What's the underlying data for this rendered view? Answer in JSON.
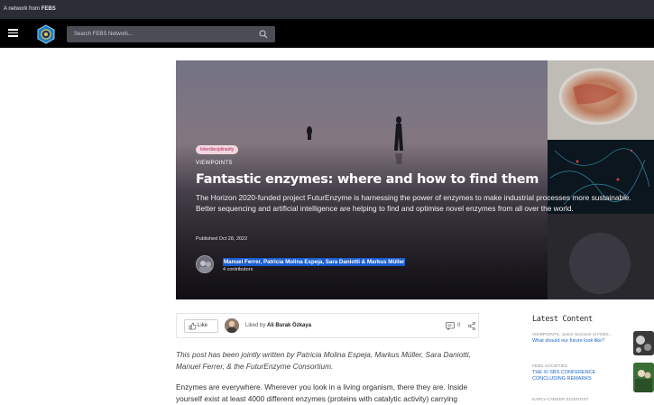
{
  "topbar": {
    "prefix": "A network from",
    "brand": "FEBS"
  },
  "nav": {
    "search_placeholder": "Search FEBS Network..."
  },
  "hero": {
    "tag": "Interdisciplinarity",
    "kicker": "VIEWPOINTS",
    "title": "Fantastic enzymes: where and how to find them",
    "subtitle": "The Horizon 2020-funded project FuturEnzyme is harnessing the power of enzymes to make industrial processes more sustainable. Better sequencing and artificial intelligence are helping to find and optimise novel enzymes from all over the world.",
    "published": "Published Oct 28, 2022",
    "authors": "Manuel Ferrer, Patricia Molina Espeja, Sara Daniotti & Markus Müller",
    "contributors": "4 contributors"
  },
  "actions": {
    "like_label": "Like",
    "liked_prefix": "Liked by",
    "liked_name": "Ali Burak Özkaya",
    "comment_count": "0"
  },
  "article": {
    "intro": "This post has been jointly written by Patricia Molina Espeja, Markus Müller, Sara Daniotti, Manuel Ferrer, & the FuturEnzyme Consortium.",
    "body": "Enzymes are everywhere. Wherever you look in a living organism, there they are. Inside yourself exist at least 4000 different enzymes (proteins with catalytic activity) carrying"
  },
  "sidebar": {
    "title": "Latest Content",
    "items": [
      {
        "category": "VIEWPOINTS, Junior Sections of FEBS...",
        "title": "What should our future look like?"
      },
      {
        "category": "FEBS SOCIETIES",
        "title": "THE XI SBS CONFERENCE CONCLUDING REMARKS"
      },
      {
        "category": "EARLY-CAREER SCIENTIST",
        "title": ""
      }
    ]
  },
  "colors": {
    "nav_bg": "#000000",
    "topstrip_bg": "#2b2d35",
    "accent_link": "#1b66c9",
    "selection": "#1a5dd0",
    "tag_bg": "#f3d7df"
  }
}
